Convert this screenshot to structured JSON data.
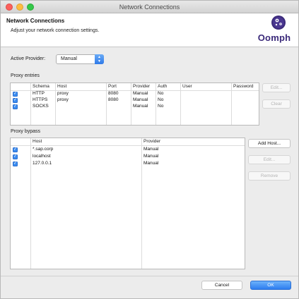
{
  "window": {
    "title": "Network Connections"
  },
  "header": {
    "title": "Network Connections",
    "subtitle": "Adjust your network connection settings.",
    "logo_text": "Oomph"
  },
  "active_provider": {
    "label": "Active Provider:",
    "value": "Manual"
  },
  "proxy_entries": {
    "label": "Proxy entries",
    "columns": [
      "Schema",
      "Host",
      "Port",
      "Provider",
      "Auth",
      "User",
      "Password"
    ],
    "rows": [
      {
        "checked": true,
        "schema": "HTTP",
        "host": "proxy",
        "port": "8080",
        "provider": "Manual",
        "auth": "No",
        "user": "",
        "password": ""
      },
      {
        "checked": true,
        "schema": "HTTPS",
        "host": "proxy",
        "port": "8080",
        "provider": "Manual",
        "auth": "No",
        "user": "",
        "password": ""
      },
      {
        "checked": true,
        "schema": "SOCKS",
        "host": "",
        "port": "",
        "provider": "Manual",
        "auth": "No",
        "user": "",
        "password": ""
      }
    ],
    "buttons": {
      "edit": "Edit...",
      "clear": "Clear"
    }
  },
  "proxy_bypass": {
    "label": "Proxy bypass",
    "columns": [
      "Host",
      "Provider"
    ],
    "rows": [
      {
        "checked": true,
        "host": "*.sap.corp",
        "provider": "Manual"
      },
      {
        "checked": true,
        "host": "localhost",
        "provider": "Manual"
      },
      {
        "checked": true,
        "host": "127.0.0.1",
        "provider": "Manual"
      }
    ],
    "buttons": {
      "add_host": "Add Host...",
      "edit": "Edit...",
      "remove": "Remove"
    }
  },
  "footer": {
    "cancel": "Cancel",
    "ok": "OK"
  },
  "colors": {
    "accent": "#2d7df0",
    "logo": "#3b2a7a"
  }
}
